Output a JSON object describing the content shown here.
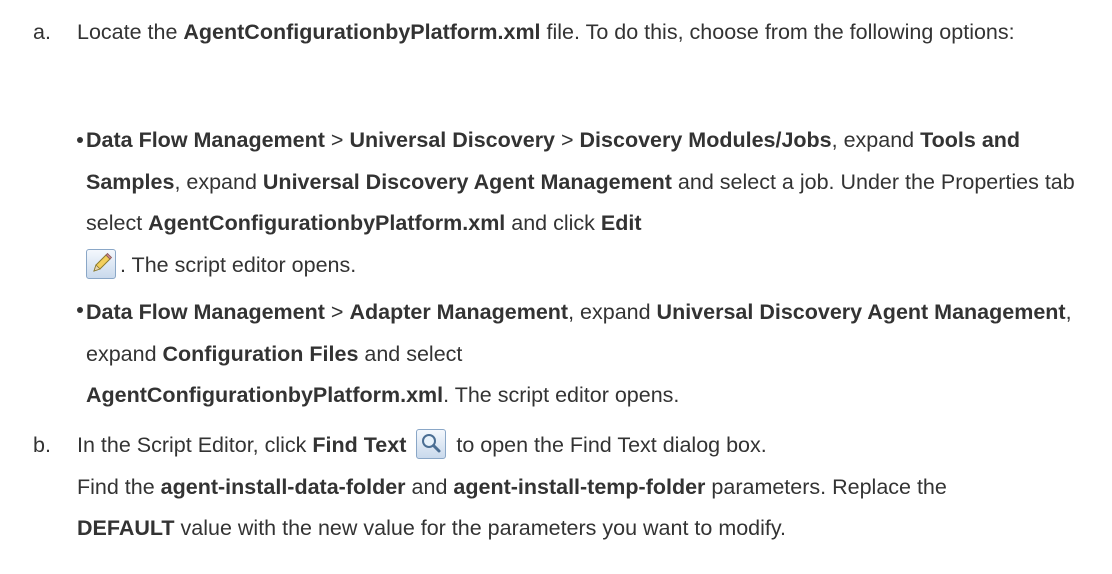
{
  "step_a": {
    "marker": "a.",
    "intro_1": "Locate the ",
    "intro_file": "AgentConfigurationbyPlatform.xml",
    "intro_2": " file. To do this, choose from the following options:",
    "bullet1": {
      "p1": "Data Flow Management",
      "sep1": " > ",
      "p2": "Universal Discovery",
      "sep2": " > ",
      "p3": "Discovery Modules/Jobs",
      "t1": ", expand ",
      "p4": "Tools and Samples",
      "t2": ", expand ",
      "p5": "Universal Discovery Agent Management",
      "t3": " and select a job. Under the Properties tab select ",
      "p6": "AgentConfigurationbyPlatform.xml",
      "t4": " and click ",
      "p7": "Edit",
      "t5": ". The script editor opens."
    },
    "bullet2": {
      "p1": "Data Flow Management",
      "sep1": " > ",
      "p2": "Adapter Management",
      "t1": ", expand ",
      "p3": "Universal Discovery Agent Management",
      "t2": ", expand ",
      "p4": "Configuration Files",
      "t3": " and select ",
      "p5": "AgentConfigurationbyPlatform.xml",
      "t4": ". The script editor opens."
    }
  },
  "step_b": {
    "marker": "b.",
    "t1": "In the Script Editor, click ",
    "p1": "Find Text",
    "t2": " to open the Find Text dialog box.",
    "t3": "Find the ",
    "p2": "agent-install-data-folder",
    "t4": " and ",
    "p3": "agent-install-temp-folder",
    "t5": " parameters. Replace the ",
    "p4": "DEFAULT",
    "t6": " value with the new value for the parameters you want to modify."
  },
  "icons": {
    "edit": "pencil-edit-icon",
    "find": "magnifier-find-icon"
  }
}
